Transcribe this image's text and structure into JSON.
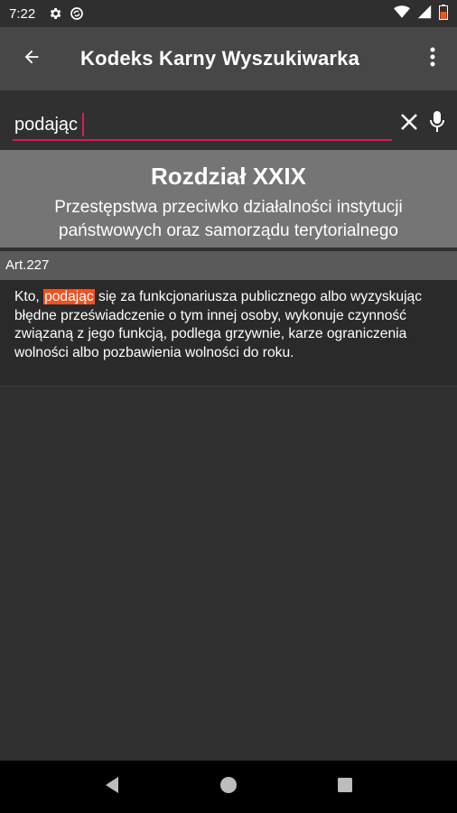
{
  "status_bar": {
    "time": "7:22",
    "icons": [
      "gear-icon",
      "sync-icon",
      "wifi-icon",
      "signal-icon",
      "battery-icon"
    ]
  },
  "app_bar": {
    "title": "Kodeks Karny Wyszukiwarka",
    "back_icon": "arrow-left-icon",
    "menu_icon": "more-vert-icon"
  },
  "search": {
    "value": "podając",
    "clear_icon": "close-icon",
    "mic_icon": "mic-icon"
  },
  "chapter": {
    "title": "Rozdział XXIX",
    "subtitle_line1": "Przestępstwa przeciwko działalności instytucji",
    "subtitle_line2": "państwowych oraz samorządu terytorialnego"
  },
  "article": {
    "label": "Art.227",
    "text_before": "Kto, ",
    "highlight": "podając",
    "text_after": " się za funkcjonariusza publicznego albo wyzyskując błędne przeświadczenie o tym innej osoby, wykonuje czynność związaną z jego funkcją, podlega grzywnie, karze ograniczenia wolności albo pozbawienia wolności do roku."
  },
  "nav_bar": {
    "icons": [
      "back-triangle-icon",
      "home-circle-icon",
      "recents-square-icon"
    ]
  },
  "colors": {
    "accent": "#d81b60",
    "highlight": "#f4511e",
    "app_bar": "#474747",
    "chapter_bg": "#757575"
  }
}
